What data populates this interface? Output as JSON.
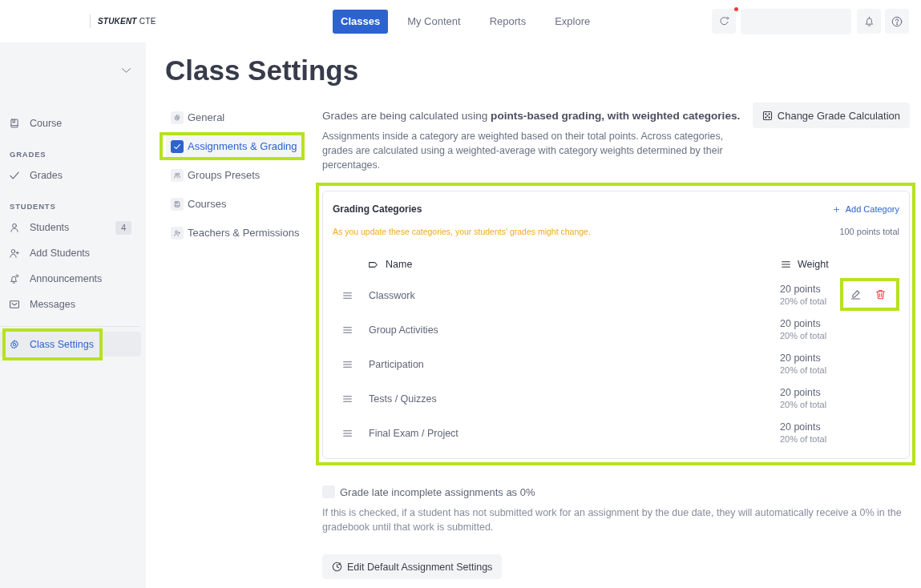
{
  "header": {
    "logo": {
      "brand": "STUKENT",
      "product": "CTE"
    },
    "tabs": [
      {
        "label": "Classes",
        "selected": true
      },
      {
        "label": "My Content",
        "selected": false
      },
      {
        "label": "Reports",
        "selected": false
      },
      {
        "label": "Explore",
        "selected": false
      }
    ],
    "notification_dot": true
  },
  "sidebar": {
    "sections": [
      {
        "items": [
          {
            "label": "Course",
            "selected": false
          }
        ]
      },
      {
        "heading": "GRADES",
        "items": [
          {
            "label": "Grades",
            "selected": false
          }
        ]
      },
      {
        "heading": "STUDENTS",
        "items": [
          {
            "label": "Students",
            "count": "4",
            "selected": false
          },
          {
            "label": "Add Students",
            "selected": false
          },
          {
            "label": "Announcements",
            "selected": false
          },
          {
            "label": "Messages",
            "selected": false
          }
        ]
      }
    ],
    "footer_items": [
      {
        "label": "Class Settings",
        "selected": true,
        "highlighted": true
      }
    ]
  },
  "page_title": "Class Settings",
  "settings_nav": [
    {
      "label": "General",
      "selected": false,
      "highlighted": false
    },
    {
      "label": "Assignments & Grading",
      "selected": true,
      "highlighted": true
    },
    {
      "label": "Groups Presets",
      "selected": false,
      "highlighted": false
    },
    {
      "label": "Courses",
      "selected": false,
      "highlighted": false
    },
    {
      "label": "Teachers & Permissions",
      "selected": false,
      "highlighted": false
    }
  ],
  "grading": {
    "summary": "Grades are being calculated using **points-based grading, with weighted categories.**",
    "change_button": "Change Grade Calculation",
    "description": "Assignments inside a category are weighted based on their total points. Across categories, grades are calculated using a weighted-average with category weights determined by their percentages."
  },
  "grading_categories": {
    "title": "Grading Categories",
    "highlighted": true,
    "add_button": "Add Category",
    "warning": "As you update these categories, your students' grades might change.",
    "total": "100 points total",
    "columns": [
      "Name",
      "Weight"
    ],
    "rows": [
      {
        "name": "Classwork",
        "points": "20 points",
        "share": "20% of total",
        "actions_visible": true,
        "actions_highlighted": true
      },
      {
        "name": "Group Activities",
        "points": "20 points",
        "share": "20% of total",
        "actions_visible": false,
        "actions_highlighted": false
      },
      {
        "name": "Participation",
        "points": "20 points",
        "share": "20% of total",
        "actions_visible": false,
        "actions_highlighted": false
      },
      {
        "name": "Tests / Quizzes",
        "points": "20 points",
        "share": "20% of total",
        "actions_visible": false,
        "actions_highlighted": false
      },
      {
        "name": "Final Exam / Project",
        "points": "20 points",
        "share": "20% of total",
        "actions_visible": false,
        "actions_highlighted": false
      }
    ]
  },
  "late_policy": {
    "label": "Grade late incomplete assignments as 0%",
    "checked": false,
    "help": "If this is checked, if a student has not submitted work for an assignment by the due date, they will automatically receive a 0% in the gradebook until that work is submitted."
  },
  "edit_defaults_button": "Edit Default Assignment Settings"
}
